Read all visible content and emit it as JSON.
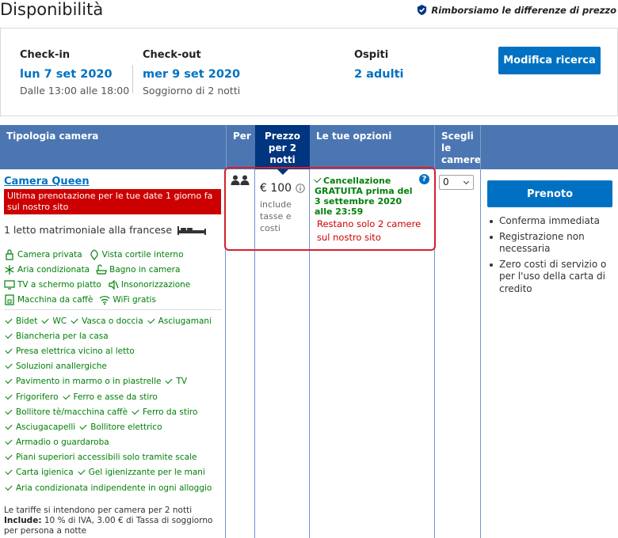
{
  "page": {
    "title": "Disponibilità",
    "refund_note": "Rimborsiamo le differenze di prezzo"
  },
  "summary": {
    "checkin": {
      "label": "Check-in",
      "value": "lun 7 set 2020",
      "note": "Dalle 13:00 alle 18:00"
    },
    "checkout": {
      "label": "Check-out",
      "value": "mer 9 set 2020",
      "note": "Soggiorno di 2 notti"
    },
    "guests": {
      "label": "Ospiti",
      "value": "2 adulti"
    },
    "modify_button": "Modifica ricerca"
  },
  "table": {
    "headers": {
      "room_type": "Tipologia camera",
      "per": "Per",
      "price": "Prezzo per 2 notti",
      "options": "Le tue opzioni",
      "choose": "Scegli le camere"
    },
    "room": {
      "name": "Camera Queen",
      "alert": "Ultima prenotazione per le tue date 1 giorno fa sul nostro sito",
      "bed": "1 letto matrimoniale alla francese",
      "facilities": [
        [
          {
            "icon": "private-room-icon",
            "label": "Camera privata"
          },
          {
            "icon": "view-icon",
            "label": "Vista cortile interno"
          }
        ],
        [
          {
            "icon": "snowflake-icon",
            "label": "Aria condizionata"
          },
          {
            "icon": "bath-icon",
            "label": "Bagno in camera"
          }
        ],
        [
          {
            "icon": "tv-icon",
            "label": "TV a schermo piatto"
          },
          {
            "icon": "soundproof-icon",
            "label": "Insonorizzazione"
          }
        ],
        [
          {
            "icon": "coffee-machine-icon",
            "label": "Macchina da caffè"
          },
          {
            "icon": "wifi-icon",
            "label": "WiFi gratis"
          }
        ]
      ],
      "amenities": [
        [
          "Bidet",
          "WC",
          "Vasca o doccia",
          "Asciugamani"
        ],
        [
          "Biancheria per la casa"
        ],
        [
          "Presa elettrica vicino al letto"
        ],
        [
          "Soluzioni anallergiche"
        ],
        [
          "Pavimento in marmo o in piastrelle",
          "TV"
        ],
        [
          "Frigorifero",
          "Ferro e asse da stiro"
        ],
        [
          "Bollitore tè/macchina caffè",
          "Ferro da stiro"
        ],
        [
          "Asciugacapelli",
          "Bollitore elettrico"
        ],
        [
          "Armadio o guardaroba"
        ],
        [
          "Piani superiori accessibili solo tramite scale"
        ],
        [
          "Carta igienica",
          "Gel igienizzante per le mani"
        ],
        [
          "Aria condizionata indipendente in ogni alloggio"
        ]
      ],
      "rate_note_line1": "Le tariffe si intendono per camera per 2 notti",
      "rate_note_include_label": "Include:",
      "rate_note_include_text": " 10 % di IVA, 3.00 € di Tassa di soggiorno per persona a notte",
      "price": "€ 100",
      "price_note": "include tasse e costi",
      "cancellation": "Cancellazione GRATUITA prima del 3 settembre 2020 alle 23:59",
      "scarcity": "Restano solo 2 camere sul nostro sito",
      "rooms_select_value": "0",
      "book_button": "Prenoto",
      "benefits": [
        "Conferma immediata",
        "Registrazione non necessaria",
        "Zero costi di servizio o per l'uso della carta di credito"
      ]
    }
  },
  "colors": {
    "brand_blue": "#0071c2",
    "header_blue": "#4c76b2",
    "dark_blue": "#003580",
    "green": "#008009",
    "red": "#cc0000"
  }
}
